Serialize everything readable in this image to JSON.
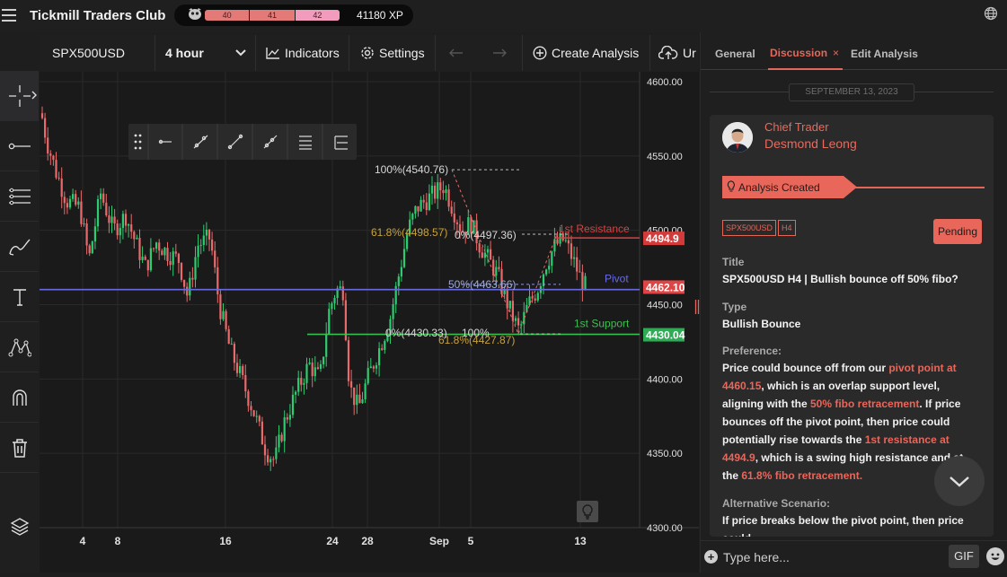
{
  "app": {
    "title": "Tickmill Traders Club"
  },
  "xp": {
    "levels": [
      "40",
      "41",
      "42"
    ],
    "value": "41180 XP"
  },
  "toolbar": {
    "symbol": "SPX500USD",
    "timeframe": "4 hour",
    "indicators": "Indicators",
    "settings": "Settings",
    "create_analysis": "Create Analysis",
    "upload_partial": "Ur"
  },
  "left_tools": [
    "crosshair-icon",
    "line-icon",
    "horizontal-lines-icon",
    "brush-icon",
    "text-icon",
    "pattern-icon",
    "magnet-icon",
    "trash-icon",
    "layers-icon"
  ],
  "chart_data": {
    "type": "candlestick",
    "symbol": "SPX500USD",
    "timeframe": "4 hour",
    "y_ticks": [
      "4600.00",
      "4550.00",
      "4500.00",
      "4450.00",
      "4400.00",
      "4350.00",
      "4300.00"
    ],
    "ylim": [
      4300,
      4600
    ],
    "x_ticks": [
      "4",
      "8",
      "16",
      "24",
      "28",
      "Sep",
      "5",
      "13"
    ],
    "price_tags": [
      {
        "label": "4494.9",
        "value": 4494.9,
        "color": "#d43a3a"
      },
      {
        "label": "4462.10",
        "value": 4462.1,
        "color": "#e04545"
      },
      {
        "label": "4430.04",
        "value": 4430.04,
        "color": "#2faa55"
      }
    ],
    "levels": [
      {
        "name": "1st Resistance",
        "value": 4494.9,
        "color": "#d94040"
      },
      {
        "name": "Pivot",
        "value": 4460.15,
        "color": "#6a6ae0"
      },
      {
        "name": "1st Support",
        "value": 4430.04,
        "color": "#3cbf50"
      }
    ],
    "fib_labels": [
      {
        "text": "100%(4540.76)",
        "value": 4540.76,
        "color": "#d8d8d8"
      },
      {
        "text": "61.8%(4498.57)",
        "value": 4498.57,
        "color": "#c8a23a"
      },
      {
        "text": "0%(4497.36)",
        "value": 4497.36,
        "color": "#d8d8d8"
      },
      {
        "text": "50%(4463.66)",
        "value": 4463.66,
        "color": "#a0a8d8"
      },
      {
        "text": "0%(4430.33)",
        "value": 4430.33,
        "color": "#d8d8d8"
      },
      {
        "text": "100%",
        "value": 4430.33,
        "color": "#d8d8d8"
      },
      {
        "text": "61.8%(4427.87)",
        "value": 4427.87,
        "color": "#c8a23a"
      }
    ]
  },
  "right_panel": {
    "tabs": [
      "General",
      "Discussion",
      "Edit Analysis"
    ],
    "active_tab": "Discussion",
    "close_symbol": "×",
    "date": "SEPTEMBER 13, 2023",
    "author_role": "Chief Trader",
    "author_name": "Desmond Leong",
    "created_label": "Analysis Created",
    "tags": [
      "SPX500USD",
      "H4"
    ],
    "status": "Pending",
    "title_label": "Title",
    "title_value": "SPX500USD H4 | Bullish bounce off 50% fibo?",
    "type_label": "Type",
    "type_value": "Bullish Bounce",
    "preference_label": "Preference:",
    "pref": {
      "t1": "Price could bounce off from our ",
      "h1": "pivot point at 4460.15",
      "t2": ", which is an overlap support level, aligning with the ",
      "h2": "50% fibo retracement",
      "t3": ". If price bounces off the pivot point, then price could potentially rise towards the ",
      "h3": "1st resistance at 4494.9",
      "t4": ", which is a swing high resistance and at the ",
      "h4": "61.8% fibo retracement."
    },
    "alt_label": "Alternative Scenario:",
    "alt_text": "If price breaks below the pivot point, then price could",
    "input_placeholder": "Type here...",
    "gif_label": "GIF"
  }
}
